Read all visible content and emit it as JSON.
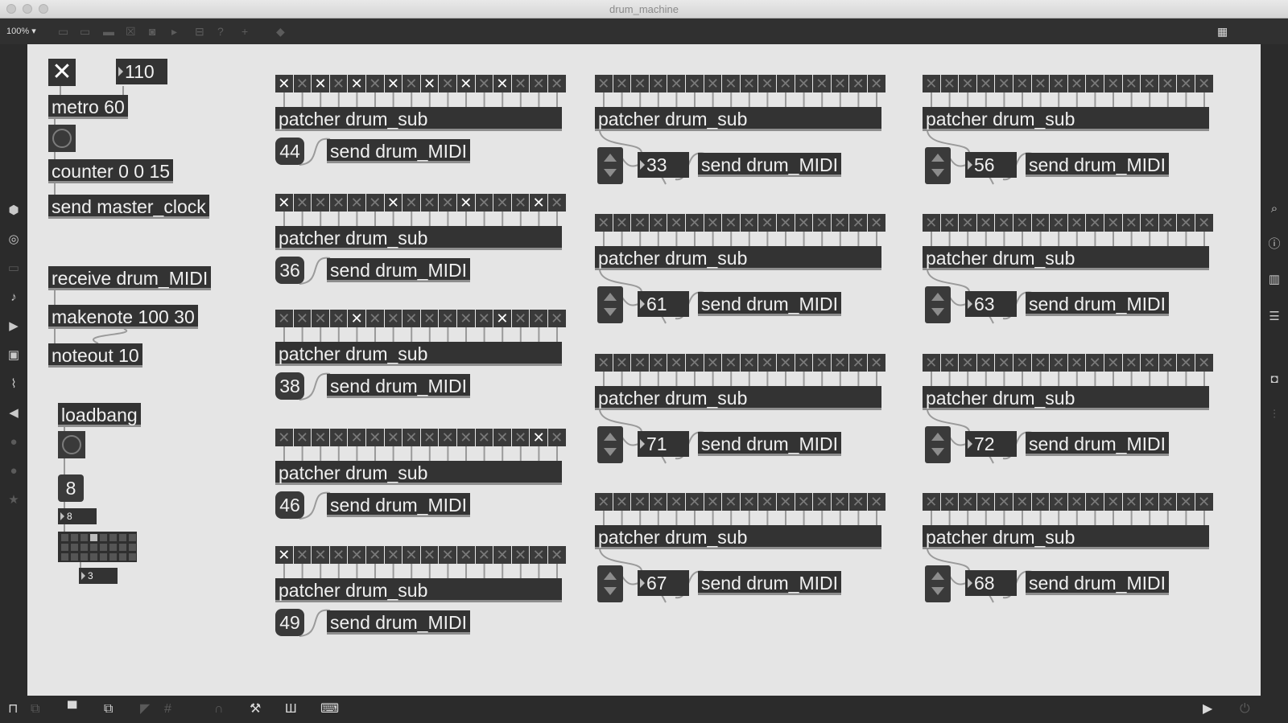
{
  "window": {
    "title": "drum_machine"
  },
  "toolbar": {
    "zoom": "100%"
  },
  "controls": {
    "toggle_glyph": "✕",
    "tempo": "110",
    "metro": "metro 60",
    "counter": "counter 0 0 15",
    "send_clock": "send master_clock",
    "receive": "receive drum_MIDI",
    "makenote": "makenote 100 30",
    "noteout": "noteout 10",
    "loadbang": "loadbang",
    "init_value": "8",
    "small_num_1": "8",
    "small_num_2": "3",
    "matrix": {
      "columns": 8,
      "rows": 3,
      "active_cells": [
        3
      ]
    }
  },
  "voices": [
    {
      "patcher": "patcher drum_sub",
      "note": "44",
      "send": "send drum_MIDI",
      "style": "round",
      "steps": [
        1,
        0,
        1,
        0,
        1,
        0,
        1,
        0,
        1,
        0,
        1,
        0,
        1,
        0,
        0,
        0
      ]
    },
    {
      "patcher": "patcher drum_sub",
      "note": "36",
      "send": "send drum_MIDI",
      "style": "round",
      "steps": [
        1,
        0,
        0,
        0,
        0,
        0,
        1,
        0,
        0,
        0,
        1,
        0,
        0,
        0,
        1,
        0
      ]
    },
    {
      "patcher": "patcher drum_sub",
      "note": "38",
      "send": "send drum_MIDI",
      "style": "round",
      "steps": [
        0,
        0,
        0,
        0,
        1,
        0,
        0,
        0,
        0,
        0,
        0,
        0,
        1,
        0,
        0,
        0
      ]
    },
    {
      "patcher": "patcher drum_sub",
      "note": "46",
      "send": "send drum_MIDI",
      "style": "round",
      "steps": [
        0,
        0,
        0,
        0,
        0,
        0,
        0,
        0,
        0,
        0,
        0,
        0,
        0,
        0,
        1,
        0
      ]
    },
    {
      "patcher": "patcher drum_sub",
      "note": "49",
      "send": "send drum_MIDI",
      "style": "round",
      "steps": [
        1,
        0,
        0,
        0,
        0,
        0,
        0,
        0,
        0,
        0,
        0,
        0,
        0,
        0,
        0,
        0
      ]
    },
    {
      "patcher": "patcher drum_sub",
      "note": "33",
      "send": "send drum_MIDI",
      "style": "stepper",
      "steps": [
        0,
        0,
        0,
        0,
        0,
        0,
        0,
        0,
        0,
        0,
        0,
        0,
        0,
        0,
        0,
        0
      ]
    },
    {
      "patcher": "patcher drum_sub",
      "note": "61",
      "send": "send drum_MIDI",
      "style": "stepper",
      "steps": [
        0,
        0,
        0,
        0,
        0,
        0,
        0,
        0,
        0,
        0,
        0,
        0,
        0,
        0,
        0,
        0
      ]
    },
    {
      "patcher": "patcher drum_sub",
      "note": "71",
      "send": "send drum_MIDI",
      "style": "stepper",
      "steps": [
        0,
        0,
        0,
        0,
        0,
        0,
        0,
        0,
        0,
        0,
        0,
        0,
        0,
        0,
        0,
        0
      ]
    },
    {
      "patcher": "patcher drum_sub",
      "note": "67",
      "send": "send drum_MIDI",
      "style": "stepper",
      "steps": [
        0,
        0,
        0,
        0,
        0,
        0,
        0,
        0,
        0,
        0,
        0,
        0,
        0,
        0,
        0,
        0
      ]
    },
    {
      "patcher": "patcher drum_sub",
      "note": "56",
      "send": "send drum_MIDI",
      "style": "stepper",
      "steps": [
        0,
        0,
        0,
        0,
        0,
        0,
        0,
        0,
        0,
        0,
        0,
        0,
        0,
        0,
        0,
        0
      ]
    },
    {
      "patcher": "patcher drum_sub",
      "note": "63",
      "send": "send drum_MIDI",
      "style": "stepper",
      "steps": [
        0,
        0,
        0,
        0,
        0,
        0,
        0,
        0,
        0,
        0,
        0,
        0,
        0,
        0,
        0,
        0
      ]
    },
    {
      "patcher": "patcher drum_sub",
      "note": "72",
      "send": "send drum_MIDI",
      "style": "stepper",
      "steps": [
        0,
        0,
        0,
        0,
        0,
        0,
        0,
        0,
        0,
        0,
        0,
        0,
        0,
        0,
        0,
        0
      ]
    },
    {
      "patcher": "patcher drum_sub",
      "note": "68",
      "send": "send drum_MIDI",
      "style": "stepper",
      "steps": [
        0,
        0,
        0,
        0,
        0,
        0,
        0,
        0,
        0,
        0,
        0,
        0,
        0,
        0,
        0,
        0
      ]
    }
  ],
  "icons": {
    "sidebar_left": [
      "cube-icon",
      "target-icon",
      "panel-icon",
      "music-note-icon",
      "media-icon",
      "image-icon",
      "paperclip-icon",
      "plug-icon",
      "v-icon",
      "clock-icon",
      "star-icon"
    ],
    "sidebar_right": [
      "search-icon",
      "info-icon",
      "book-icon",
      "list-icon",
      "camera-icon",
      "mixer-icon"
    ],
    "bottom": [
      "lock-icon",
      "edit-icon",
      "comment-icon",
      "windows-icon",
      "presentation-icon",
      "grid-icon",
      "magnet-icon",
      "wrench-icon",
      "columns-icon",
      "keyboard-icon",
      "play-icon",
      "power-icon"
    ]
  }
}
